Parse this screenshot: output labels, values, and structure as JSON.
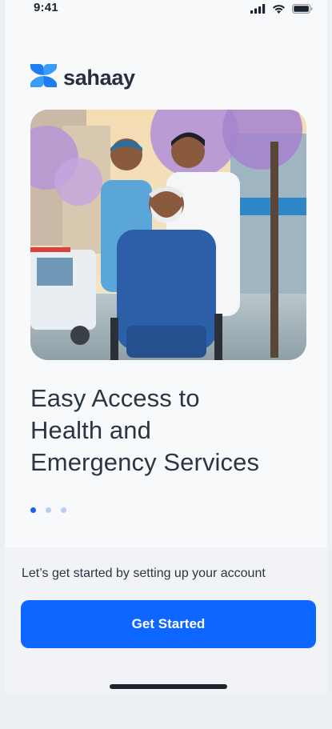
{
  "status_bar": {
    "time": "9:41",
    "icons": [
      "cellular-signal-icon",
      "wifi-icon",
      "battery-icon"
    ]
  },
  "brand": {
    "name": "sahaay",
    "logo_icon": "sahaay-logo-icon",
    "logo_color": "#1e7df0"
  },
  "hero": {
    "image": "illustration of two nurses assisting an elderly man in a wheelchair"
  },
  "headline": {
    "lines": [
      "Easy Access to",
      "Health and",
      "Emergency Services"
    ]
  },
  "pager": {
    "count": 3,
    "active_index": 0,
    "active_color": "#1463f0",
    "inactive_color": "#b9cff0"
  },
  "onboarding": {
    "setup_text": "Let’s get started by setting up your account",
    "cta_label": "Get Started",
    "cta_color": "#0d66ff"
  }
}
